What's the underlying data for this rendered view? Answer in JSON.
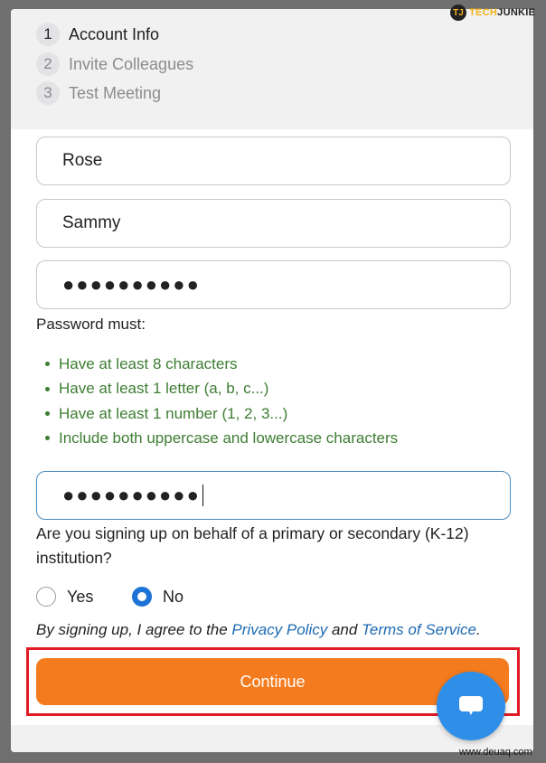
{
  "steps": [
    {
      "num": "1",
      "label": "Account Info"
    },
    {
      "num": "2",
      "label": "Invite Colleagues"
    },
    {
      "num": "3",
      "label": "Test Meeting"
    }
  ],
  "form": {
    "first_name": "Rose",
    "last_name": "Sammy",
    "password_mask": "●●●●●●●●●●",
    "confirm_password_mask": "●●●●●●●●●●"
  },
  "password_rules": {
    "title": "Password must:",
    "items": [
      "Have at least 8 characters",
      "Have at least 1 letter (a, b, c...)",
      "Have at least 1 number (1, 2, 3...)",
      "Include both uppercase and lowercase characters"
    ]
  },
  "k12_question": {
    "text": "Are you signing up on behalf of a primary or secondary (K-12) institution?",
    "options": [
      "Yes",
      "No"
    ],
    "selected": "No"
  },
  "terms": {
    "prefix": "By signing up, I agree to the ",
    "privacy_link": "Privacy Policy",
    "and": " and ",
    "terms_link": "Terms of Service",
    "suffix": "."
  },
  "continue_label": "Continue",
  "icons": {
    "chat": "chat-bubble-icon"
  },
  "colors": {
    "accent_orange": "#f47b1e",
    "link_blue": "#1d6ab2",
    "rule_green": "#3e7d33",
    "radio_blue": "#1e74d6",
    "highlight_red": "#e01b24",
    "chat_blue": "#2f8fe8"
  },
  "logo": {
    "badge": "TJ",
    "tech": "TECH",
    "junkie": "JUNKIE"
  },
  "watermark": "www.deuaq.com"
}
